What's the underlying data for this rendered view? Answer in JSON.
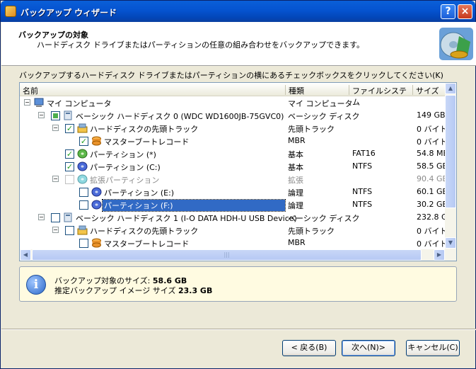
{
  "window": {
    "title": "バックアップ ウィザード",
    "help": "?",
    "close": "×"
  },
  "header": {
    "title": "バックアップの対象",
    "subtitle": "ハードディスク ドライブまたはパーティションの任意の組み合わせをバックアップできます。"
  },
  "instruction": "バックアップするハードディスク ドライブまたはパーティションの横にあるチェックボックスをクリックしてください(K)",
  "columns": [
    "名前",
    "種類",
    "ファイルシステム",
    "サイズ"
  ],
  "rows": [
    {
      "name": "マイ コンピュータ",
      "type": "マイ コンピュータ",
      "fs": "",
      "size": ""
    },
    {
      "name": "ベーシック ハードディスク 0 (WDC WD1600JB-75GVC0)",
      "type": "ベーシック ディスク",
      "fs": "",
      "size": "149 GB"
    },
    {
      "name": "ハードディスクの先頭トラック",
      "type": "先頭トラック",
      "fs": "",
      "size": "0 バイト"
    },
    {
      "name": "マスターブートレコード",
      "type": "MBR",
      "fs": "",
      "size": "0 バイト"
    },
    {
      "name": "パーティション (*)",
      "type": "基本",
      "fs": "FAT16",
      "size": "54.8 MB"
    },
    {
      "name": "パーティション (C:)",
      "type": "基本",
      "fs": "NTFS",
      "size": "58.5 GB"
    },
    {
      "name": "拡張パーティション",
      "type": "拡張",
      "fs": "",
      "size": "90.4 GB"
    },
    {
      "name": "パーティション (E:)",
      "type": "論理",
      "fs": "NTFS",
      "size": "60.1 GB"
    },
    {
      "name": "パーティション (F:)",
      "type": "論理",
      "fs": "NTFS",
      "size": "30.2 GB"
    },
    {
      "name": "ベーシック ハードディスク 1 (I-O DATA HDH-U USB Device)",
      "type": "ベーシック ディスク",
      "fs": "",
      "size": "232.8 GB"
    },
    {
      "name": "ハードディスクの先頭トラック",
      "type": "先頭トラック",
      "fs": "",
      "size": "0 バイト"
    },
    {
      "name": "マスターブートレコード",
      "type": "MBR",
      "fs": "",
      "size": "0 バイト"
    }
  ],
  "info": {
    "size_label": "バックアップ対象のサイズ:",
    "size_value": "58.6 GB",
    "image_label": "推定バックアップ イメージ サイズ",
    "image_value": "23.3 GB",
    "icon": "i"
  },
  "buttons": {
    "back": "< 戻る(B)",
    "next": "次へ(N)>",
    "cancel": "キャンセル(C)"
  },
  "colors": {
    "title_bar": "#0553d0",
    "selection": "#316ac5",
    "check": "#21a121"
  }
}
